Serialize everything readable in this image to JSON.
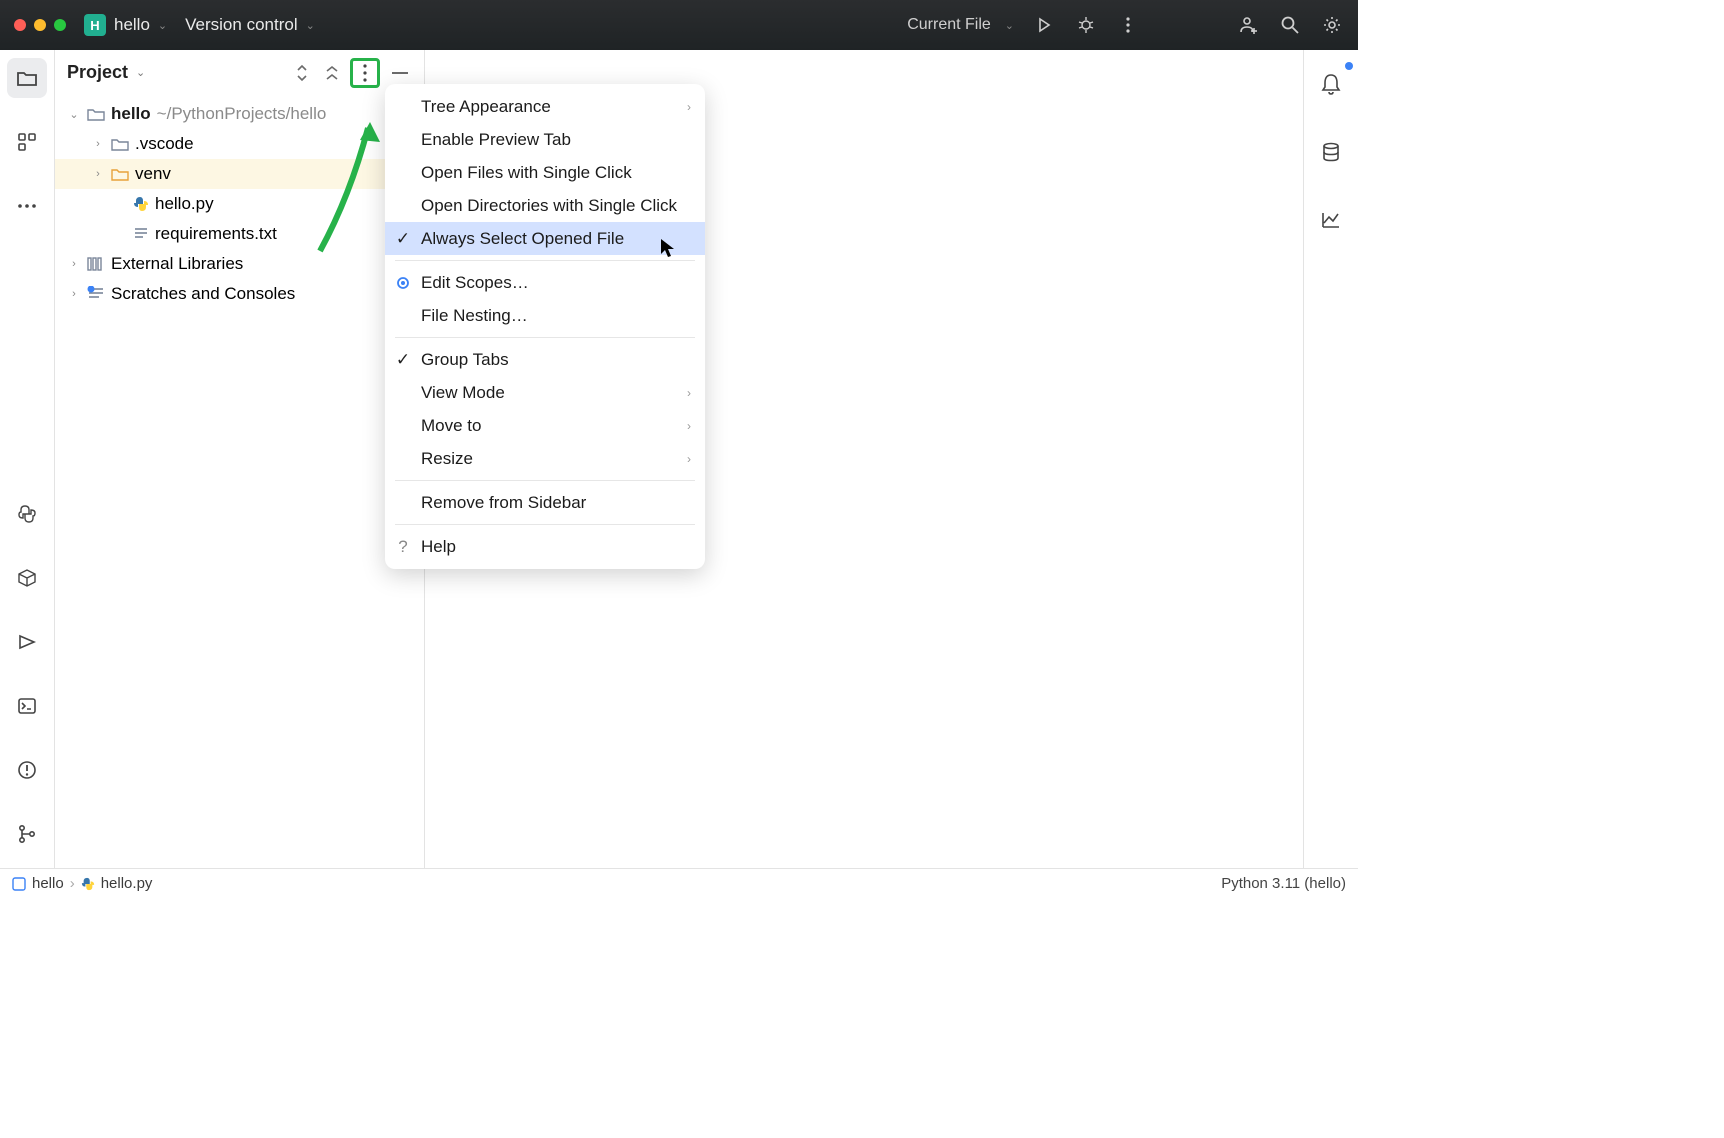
{
  "titlebar": {
    "project_name": "hello",
    "version_control_label": "Version control",
    "run_config": "Current File"
  },
  "project_panel": {
    "title": "Project",
    "root_name": "hello",
    "root_path": "~/PythonProjects/hello",
    "vscode_folder": ".vscode",
    "venv_folder": "venv",
    "hello_py": "hello.py",
    "requirements": "requirements.txt",
    "external_libraries": "External Libraries",
    "scratches": "Scratches and Consoles"
  },
  "context_menu": {
    "tree_appearance": "Tree Appearance",
    "enable_preview_tab": "Enable Preview Tab",
    "open_files_single": "Open Files with Single Click",
    "open_dirs_single": "Open Directories with Single Click",
    "always_select_opened": "Always Select Opened File",
    "edit_scopes": "Edit Scopes…",
    "file_nesting": "File Nesting…",
    "group_tabs": "Group Tabs",
    "view_mode": "View Mode",
    "move_to": "Move to",
    "resize": "Resize",
    "remove_from_sidebar": "Remove from Sidebar",
    "help": "Help"
  },
  "statusbar": {
    "crumb_project": "hello",
    "crumb_file": "hello.py",
    "interpreter": "Python 3.11 (hello)"
  }
}
